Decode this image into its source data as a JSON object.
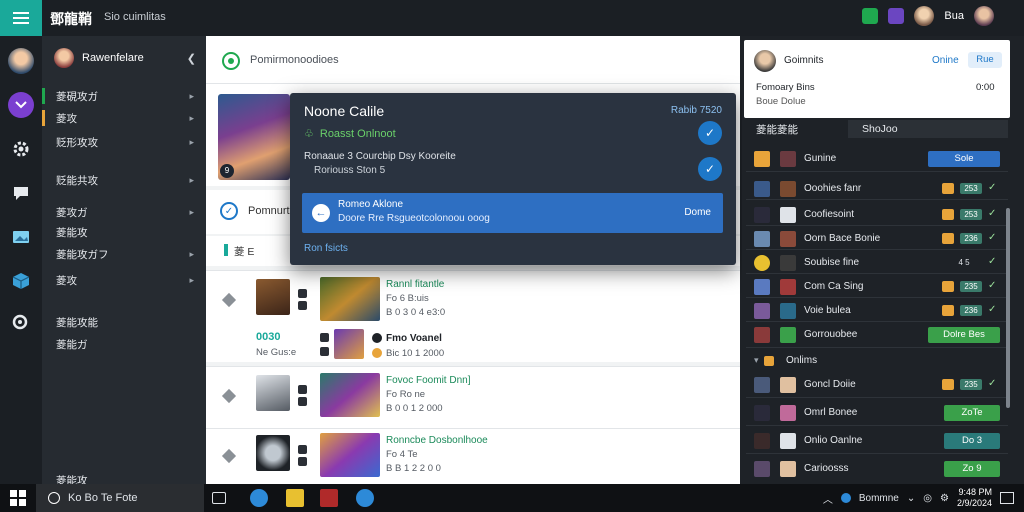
{
  "topbar": {
    "app_title": "鄧龍鞘",
    "subtitle": "Sio cuimlitas",
    "user_name": "Bua"
  },
  "sidebar": {
    "profile_name": "Rawenfelare",
    "items": [
      {
        "label": "菱硯攻ガ",
        "has_arrow": true
      },
      {
        "label": "菱攻",
        "has_arrow": true
      },
      {
        "label": "贬形攻攻",
        "has_arrow": true
      },
      {
        "label": "贬能共攻",
        "has_arrow": true
      },
      {
        "label": "菱攻ガ",
        "has_arrow": true
      },
      {
        "label": "菱能攻",
        "has_arrow": false
      },
      {
        "label": "菱能攻ガフ",
        "has_arrow": true
      },
      {
        "label": "菱攻",
        "has_arrow": true
      },
      {
        "label": "菱能攻能",
        "has_arrow": false
      },
      {
        "label": "菱能ガ",
        "has_arrow": false
      },
      {
        "label": "菱能攻",
        "has_arrow": false
      }
    ]
  },
  "main": {
    "header_text": "Pomirmonoodioes",
    "section_text": "Pomnurt",
    "tab_label": "菱 E",
    "rows": [
      {
        "title": "Rannl fitantle",
        "line1": "Fo 6 B:uis",
        "line2": "B 0 3 0 4 e3:0",
        "count": "0030",
        "sub": "Ne Gus:e"
      },
      {
        "title": "Fmo Voanel",
        "line2": "Bic 10 1 2000"
      },
      {
        "title": "Fovoc Foomit Dnn]",
        "line1": "Fo Ro ne",
        "line2": "B 0 0 1 2 000"
      },
      {
        "title": "Ronncbe Dosbonlhooe",
        "line1": "Fo 4 Te",
        "line2": "B B 1 2 2 0 0"
      }
    ]
  },
  "popup": {
    "title": "Noone Calile",
    "tag": "Rabib 7520",
    "status": "Roasst  Onlnoot",
    "line1": "Ronaaue 3 Courcbip Dsy Kooreite",
    "line2": "Roriouss Ston 5",
    "banner_line1": "Romeo Aklone",
    "banner_line2": "Doore Rre Rsgueotcolonoou ooog",
    "banner_right": "Dome",
    "footer": "Ron fsicts"
  },
  "right_panel": {
    "card": {
      "name": "Goimnits",
      "status": "Onine",
      "button": "Rue",
      "desc": "Fomoary Bins",
      "time": "0:00",
      "sub": "Boue Dolue"
    },
    "tab1": "菱能菱能",
    "tab2": "ShoJoo",
    "rows": [
      {
        "name": "Gunine",
        "badge": "Sole",
        "badge_type": "button"
      },
      {
        "name": "Ooohies fanr",
        "tag": "253"
      },
      {
        "name": "Coofiesoint",
        "tag": "253"
      },
      {
        "name": "Oorn Bace Bonie",
        "tag": "236"
      },
      {
        "name": "Soubise fine",
        "tag": "4 5"
      },
      {
        "name": "Com Ca Sing",
        "tag": "235"
      },
      {
        "name": "Voie bulea",
        "tag": "236"
      },
      {
        "name": "Gorrouobee",
        "badge": "Dolre Bes",
        "badge_type": "green"
      },
      {
        "name": "Onlims",
        "section": true
      },
      {
        "name": "Goncl Doiie",
        "tag": "235"
      },
      {
        "name": "Omrl Bonee",
        "badge": "ZoTe",
        "badge_type": "green_small"
      },
      {
        "name": "Onlio Oanlne",
        "badge": "Do 3",
        "badge_type": "teal_small"
      },
      {
        "name": "Carioosss",
        "badge": "Zo 9",
        "badge_type": "green_small"
      }
    ]
  },
  "taskbar": {
    "search_text": "Ko Bo Te Fote",
    "tray_label": "Bommne",
    "time": "9:48 PM",
    "date": "2/9/2024"
  },
  "colors": {
    "accent_teal": "#1aa99a",
    "accent_blue": "#1e78c8",
    "status_green": "#1fa84f",
    "popup_bg": "#2a3340"
  }
}
